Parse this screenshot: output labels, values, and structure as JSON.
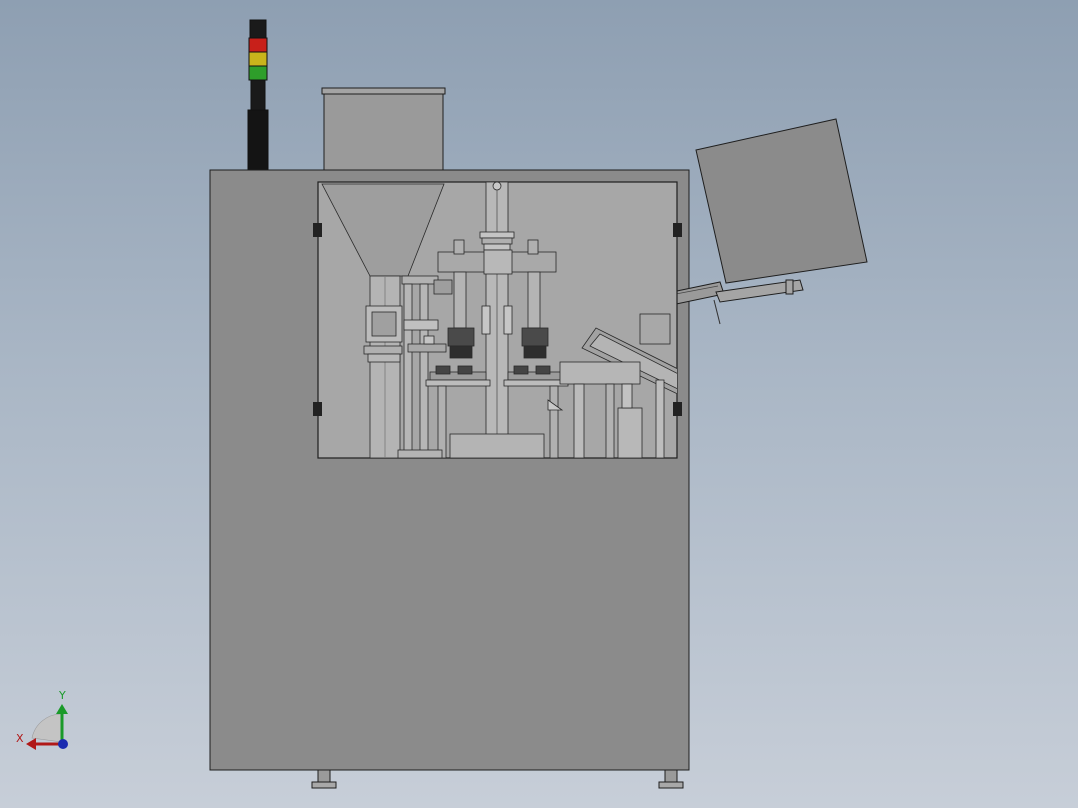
{
  "view": {
    "background_top": "#8e9fb2",
    "background_bottom": "#c7ced8"
  },
  "model": {
    "body_color": "#8b8b8b",
    "edge_color": "#1e1e1e",
    "window_color": "#a7a7a7",
    "signal_tower": {
      "light_colors": [
        "#1a1a1a",
        "#c8201a",
        "#c9b41c",
        "#2e9e2a"
      ]
    }
  },
  "triad": {
    "x_label": "X",
    "y_label": "Y",
    "x_color": "#b01818",
    "y_color": "#1a9a2a",
    "z_color": "#1a2ab0"
  }
}
